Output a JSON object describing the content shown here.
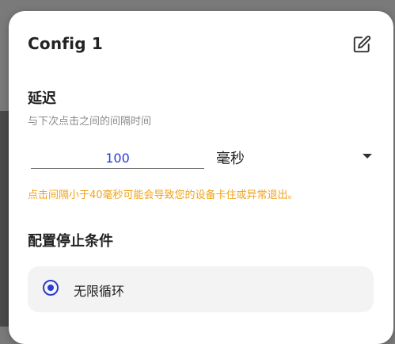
{
  "dialog": {
    "title": "Config 1",
    "edit_icon": "edit-square-icon"
  },
  "delay": {
    "title": "延迟",
    "description": "与下次点击之间的间隔时间",
    "value": "100",
    "unit": "毫秒",
    "warning": "点击间隔小于40毫秒可能会导致您的设备卡住或异常退出。"
  },
  "stop_condition": {
    "title": "配置停止条件",
    "options": [
      {
        "label": "无限循环",
        "selected": true
      }
    ]
  },
  "colors": {
    "accent": "#2a3dd1",
    "warning": "#f0a31a"
  }
}
